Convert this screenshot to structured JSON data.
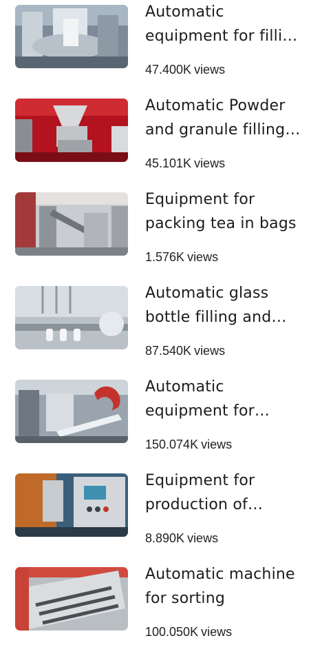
{
  "videos": [
    {
      "title": "Automatic equipment for filling capsules",
      "views": "47.400K",
      "views_label": "views",
      "thumb_icon": "capsule-filling-machine-thumbnail"
    },
    {
      "title": "Automatic Powder and granule filling machine",
      "views": "45.101K",
      "views_label": "views",
      "thumb_icon": "powder-filling-machine-thumbnail"
    },
    {
      "title": "Equipment for packing tea in bags",
      "views": "1.576K",
      "views_label": "views",
      "thumb_icon": "tea-packing-machine-thumbnail"
    },
    {
      "title": "Automatic glass bottle filling and capping line",
      "views": "87.540K",
      "views_label": "views",
      "thumb_icon": "bottle-filling-line-thumbnail"
    },
    {
      "title": "Automatic equipment for packaging",
      "views": "150.074K",
      "views_label": "views",
      "thumb_icon": "packaging-machine-thumbnail"
    },
    {
      "title": "Equipment for production of tablets",
      "views": "8.890K",
      "views_label": "views",
      "thumb_icon": "tablet-press-thumbnail"
    },
    {
      "title": "Automatic machine for sorting",
      "views": "100.050K",
      "views_label": "views",
      "thumb_icon": "sorting-machine-thumbnail"
    }
  ]
}
